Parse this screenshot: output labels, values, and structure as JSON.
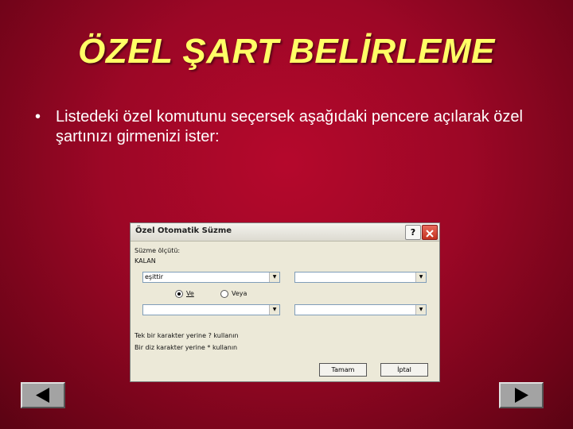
{
  "slide": {
    "title": "ÖZEL ŞART BELİRLEME",
    "bullet_symbol": "•",
    "bullet_text": "Listedeki özel komutunu seçersek aşağıdaki pencere açılarak özel şartınızı girmenizi ister:"
  },
  "dialog": {
    "title": "Özel Otomatik Süzme",
    "help_label": "?",
    "criteria_label": "Süzme ölçütü:",
    "field_label": "KALAN",
    "row1": {
      "operator": "eşittir",
      "value": ""
    },
    "logic": {
      "and_label": "Ve",
      "or_label": "Veya",
      "selected": "Ve"
    },
    "row2": {
      "operator": "",
      "value": ""
    },
    "hint1": "Tek bir karakter yerine ? kullanın",
    "hint2": "Bir diz karakter yerine * kullanın",
    "ok_label": "Tamam",
    "cancel_label": "İptal"
  },
  "nav": {
    "back_icon": "triangle-left-icon",
    "forward_icon": "triangle-right-icon"
  }
}
